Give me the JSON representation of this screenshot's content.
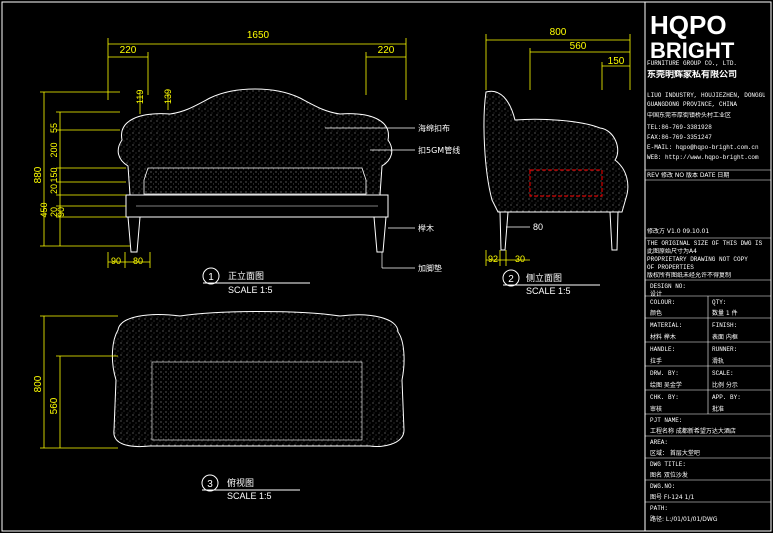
{
  "drawing": {
    "front_view": {
      "dims_top": [
        "1650",
        "220",
        "220"
      ],
      "dims_left": [
        "880",
        "55",
        "200",
        "150",
        "20",
        "450",
        "90",
        "20"
      ],
      "dims_inner": [
        "119",
        "139"
      ],
      "dims_bottom": [
        "90",
        "80"
      ],
      "callouts": [
        "海绵扣布",
        "扣5GM管线",
        "榉木",
        "加脚垫"
      ],
      "view_number": "1",
      "view_title": "正立面图",
      "scale": "SCALE 1:5"
    },
    "side_view": {
      "dims_top": [
        "800",
        "560",
        "150"
      ],
      "dims_bottom": [
        "92",
        "30",
        "80"
      ],
      "view_number": "2",
      "view_title": "侧立面图",
      "scale": "SCALE 1:5"
    },
    "top_view": {
      "dims_left": [
        "800",
        "560"
      ],
      "view_number": "3",
      "view_title": "俯视图",
      "scale": "SCALE 1:5"
    }
  },
  "title_block": {
    "logo_top": "HQPO",
    "logo_bottom": "BRIGHT",
    "company_en": "FURNITURE GROUP CO., LTD.",
    "company_cn": "东莞明辉家私有限公司",
    "address_en_1": "LIUO INDUSTRY, HOUJIEZHEN, DONGGUAN",
    "address_en_2": "GUANGDONG PROVINCE, CHINA",
    "address_cn": "中国东莞市厚街镇桥头村工业区",
    "tel": "TEL:86-769-3381928",
    "fax": "FAX:86-769-3351247",
    "email": "E-MAIL: hqpo@hqpo-bright.com.cn",
    "web": "WEB: http://www.hqpo-bright.com",
    "revision_header": "REV 修改   NO 版本   DATE 日期",
    "revision_row": "修改方   V1.0   09.10.01",
    "notice_1": "THE ORIGINAL SIZE OF THIS DWG IS A4",
    "notice_2": "此图原始尺寸为A4",
    "notice_3": "PROPRIETARY DRAWING NOT COPY",
    "notice_4": "OF PROPERTIES",
    "notice_5": "版权所有图纸未经允许不得复制",
    "design_no_label": "DESIGN NO:",
    "design_no_value": "设计",
    "colour_label": "COLOUR:",
    "colour_value": "颜色",
    "qty_label": "QTY:",
    "qty_value": "数量 1 件",
    "material_label": "MATERIAL:",
    "material_value": "材料  榉木",
    "finish_label": "FINISH:",
    "finish_value": "表面 内框",
    "handle_label": "HANDLE:",
    "handle_value": "拉手",
    "runner_label": "RUNNER:",
    "runner_value": "滑轨",
    "drawn_label": "DRW. BY:",
    "drawn_value": "绘图 吴金学",
    "scale_label": "SCALE:",
    "scale_value": "比例 分示",
    "checked_label": "CHK. BY:",
    "checked_value": "审核",
    "approved_label": "APP. BY:",
    "approved_value": "批准",
    "project_label": "PJT NAME:",
    "project_value": "工程名称  成都新希望万达大酒店",
    "area_label": "AREA:",
    "area_value": "区域：       首层大堂吧",
    "dwg_title_label": "DWG TITLE:",
    "dwg_title_value": "图名        双位沙发",
    "dwg_no_label": "DWG.NO:",
    "dwg_no_value": "图号   FI-124    1/1",
    "path_label": "PATH:",
    "path_value": "路径: L:/01/01/01/DWG"
  },
  "colors": {
    "background": "#000000",
    "lines": "#ffffff",
    "dimension": "#ffff00",
    "logo": "#ffffff",
    "section": "#ff0000"
  }
}
